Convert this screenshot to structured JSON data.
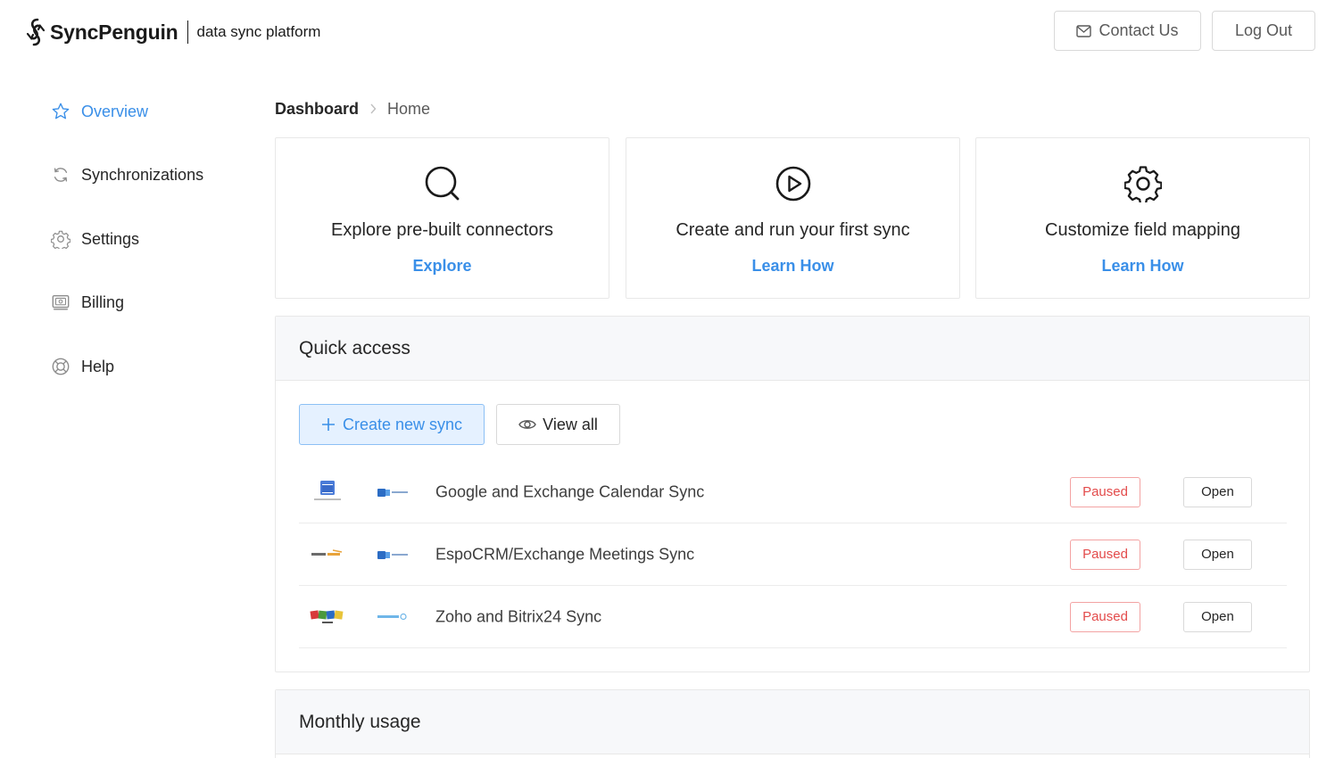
{
  "header": {
    "brand_name": "SyncPenguin",
    "tagline": "data sync platform",
    "contact_label": "Contact Us",
    "logout_label": "Log Out"
  },
  "sidebar": {
    "items": [
      {
        "label": "Overview",
        "icon": "star-icon",
        "active": true
      },
      {
        "label": "Synchronizations",
        "icon": "sync-icon",
        "active": false
      },
      {
        "label": "Settings",
        "icon": "gear-icon",
        "active": false
      },
      {
        "label": "Billing",
        "icon": "billing-icon",
        "active": false
      },
      {
        "label": "Help",
        "icon": "lifebuoy-icon",
        "active": false
      }
    ]
  },
  "breadcrumb": {
    "root": "Dashboard",
    "current": "Home"
  },
  "cards": [
    {
      "title": "Explore pre-built connectors",
      "link": "Explore",
      "icon": "search-icon"
    },
    {
      "title": "Create and run your first sync",
      "link": "Learn How",
      "icon": "play-circle-icon"
    },
    {
      "title": "Customize field mapping",
      "link": "Learn How",
      "icon": "gear-icon"
    }
  ],
  "quick_access": {
    "title": "Quick access",
    "create_label": "Create new sync",
    "view_all_label": "View all",
    "syncs": [
      {
        "name": "Google and Exchange Calendar Sync",
        "status": "Paused",
        "action": "Open",
        "logo1": "google-calendar-logo",
        "logo2": "exchange-logo"
      },
      {
        "name": "EspoCRM/Exchange Meetings Sync",
        "status": "Paused",
        "action": "Open",
        "logo1": "espocrm-logo",
        "logo2": "exchange-logo"
      },
      {
        "name": "Zoho and Bitrix24 Sync",
        "status": "Paused",
        "action": "Open",
        "logo1": "zoho-crm-logo",
        "logo2": "bitrix24-logo"
      }
    ]
  },
  "monthly_usage": {
    "title": "Monthly usage"
  },
  "colors": {
    "accent": "#3a8fe8",
    "paused": "#e34b4b"
  }
}
